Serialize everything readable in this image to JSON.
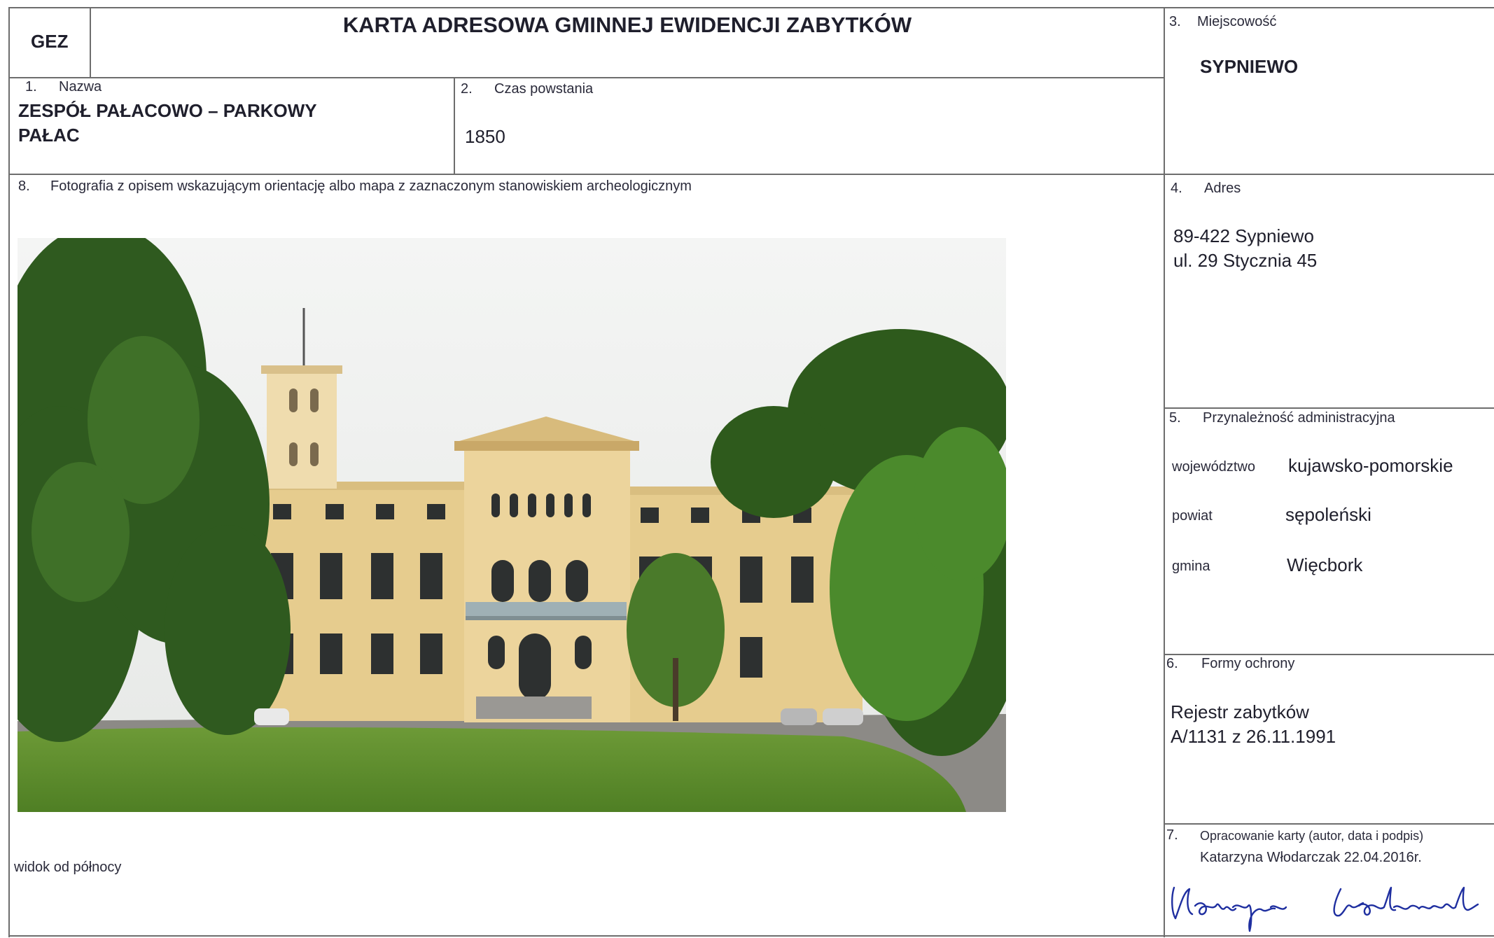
{
  "header": {
    "code": "GEZ",
    "title": "KARTA ADRESOWA GMINNEJ EWIDENCJI ZABYTKÓW"
  },
  "fields": {
    "name": {
      "num": "1.",
      "label": "Nazwa",
      "line1": "ZESPÓŁ PAŁACOWO – PARKOWY",
      "line2": "PAŁAC"
    },
    "date": {
      "num": "2.",
      "label": "Czas powstania",
      "value": "1850"
    },
    "place": {
      "num": "3.",
      "label": "Miejscowość",
      "value": "SYPNIEWO"
    },
    "address": {
      "num": "4.",
      "label": "Adres",
      "line1": "89-422 Sypniewo",
      "line2": "ul. 29 Stycznia 45"
    },
    "admin": {
      "num": "5.",
      "label": "Przynależność administracyjna",
      "rows": [
        {
          "key": "województwo",
          "value": "kujawsko-pomorskie"
        },
        {
          "key": "powiat",
          "value": "sępoleński"
        },
        {
          "key": "gmina",
          "value": "Więcbork"
        }
      ]
    },
    "protection": {
      "num": "6.",
      "label": "Formy ochrony",
      "line1": "Rejestr zabytków",
      "line2": "A/1131 z 26.11.1991"
    },
    "author": {
      "num": "7.",
      "label": "Opracowanie karty (autor, data i podpis)",
      "value": "Katarzyna Włodarczak 22.04.2016r.",
      "signature_text": "Katarzyna Włodarczak"
    },
    "photo": {
      "num": "8.",
      "label": "Fotografia z opisem wskazującym orientację albo mapa z zaznaczonym stanowiskiem archeologicznym",
      "caption": "widok od północy"
    }
  },
  "colors": {
    "facade": "#e8cf93",
    "trim": "#f3e6c2",
    "grass": "#5f8f2e",
    "trees": "#2f5a1f",
    "sky": "#eef0ee",
    "signature": "#1f2fa0"
  }
}
